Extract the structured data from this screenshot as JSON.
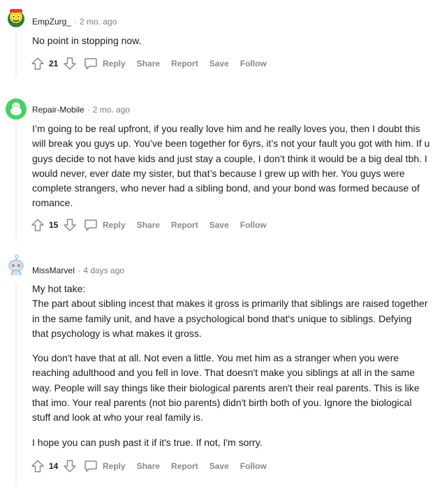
{
  "comments": [
    {
      "author": "EmpZurg_",
      "separator": "·",
      "time": "2 mo. ago",
      "paragraphs": [
        "No point in stopping now."
      ],
      "score": "21",
      "actions": {
        "reply": "Reply",
        "share": "Share",
        "report": "Report",
        "save": "Save",
        "follow": "Follow"
      }
    },
    {
      "author": "Repair-Mobile",
      "separator": "·",
      "time": "2 mo. ago",
      "paragraphs": [
        "I’m going to be real upfront, if you really love him and he really loves you, then I doubt this will break you guys up. You’ve been together for 6yrs, it’s not your fault you got with him. If u guys decide to not have kids and just stay a couple, I don’t think it would be a big deal tbh. I would never, ever date my sister, but that’s because I grew up with her. You guys were complete strangers, who never had a sibling bond, and your bond was formed because of romance."
      ],
      "score": "15",
      "actions": {
        "reply": "Reply",
        "share": "Share",
        "report": "Report",
        "save": "Save",
        "follow": "Follow"
      }
    },
    {
      "author": "MissMarveI",
      "separator": "·",
      "time": "4 days ago",
      "paragraphs": [
        "My hot take:",
        "The part about sibling incest that makes it gross is primarily that siblings are raised together in the same family unit, and have a psychological bond that's unique to siblings. Defying that psychology is what makes it gross.",
        "You don't have that at all. Not even a little. You met him as a stranger when you were reaching adulthood and you fell in love. That doesn't make you siblings at all in the same way. People will say things like their biological parents aren't their real parents. This is like that imo. Your real parents (not bio parents) didn't birth both of you. Ignore the biological stuff and look at who your real family is.",
        "I hope you can push past it if it's true. If not, I'm sorry."
      ],
      "score": "14",
      "actions": {
        "reply": "Reply",
        "share": "Share",
        "report": "Report",
        "save": "Save",
        "follow": "Follow"
      }
    }
  ],
  "colors": {
    "meta": "#7c7c7c",
    "action": "#878a8c",
    "thread": "#edeff1",
    "text": "#1c1c1c"
  }
}
